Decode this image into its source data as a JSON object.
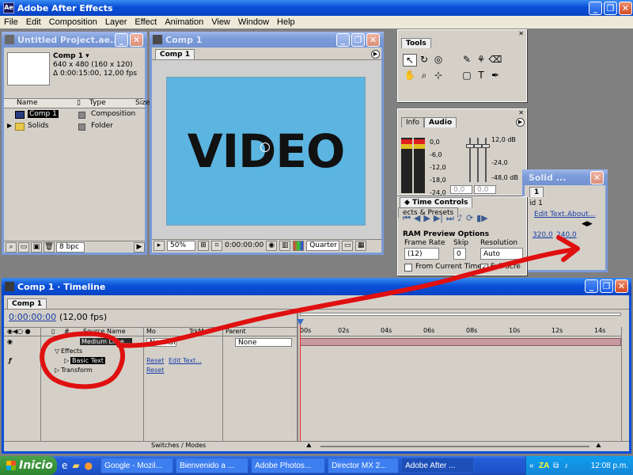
{
  "app": {
    "title": "Adobe After Effects"
  },
  "menu": [
    "File",
    "Edit",
    "Composition",
    "Layer",
    "Effect",
    "Animation",
    "View",
    "Window",
    "Help"
  ],
  "project": {
    "title": "Untitled Project.ae...",
    "comp_name": "Comp 1 ▾",
    "comp_info1": "640 x 480  (160 x 120)",
    "comp_info2": "Δ 0:00:15:00, 12,00 fps",
    "col_name": "Name",
    "col_type": "Type",
    "col_size": "Size",
    "items": [
      {
        "name": "Comp 1",
        "type": "Composition"
      },
      {
        "name": "Solids",
        "type": "Folder"
      }
    ],
    "bpc": "8 bpc"
  },
  "comp": {
    "title": "Comp 1",
    "tab": "Comp 1",
    "video_text": "VIDEO",
    "zoom": "50%",
    "time": "0:00:00:00",
    "resolution": "Quarter"
  },
  "tools": {
    "title": "Tools"
  },
  "audio": {
    "tab_info": "Info",
    "tab_audio": "Audio",
    "left_scale": [
      "0,0",
      "-6,0",
      "-12,0",
      "-18,0",
      "-24,0"
    ],
    "right_scale": [
      "12,0 dB",
      "-24,0",
      "-48,0 dB"
    ],
    "field1": "0,0",
    "field2": "0,0"
  },
  "time_controls": {
    "title": "Time Controls",
    "tab2": "ects & Presets",
    "ram_preview": "RAM Preview Options",
    "frame_rate_label": "Frame Rate",
    "frame_rate": "(12)",
    "skip_label": "Skip",
    "skip": "0",
    "resolution_label": "Resolution",
    "resolution": "Auto",
    "from_current": "From Current Time",
    "full_screen": "Full Scre"
  },
  "solid": {
    "title": "Solid ...",
    "tab": "1",
    "comp_label": "id 1",
    "edit_text": "Edit Text...",
    "about": "About...",
    "x": "320,0",
    "y": "240,0"
  },
  "timeline": {
    "title": "Comp 1 · Timeline",
    "tab": "Comp 1",
    "time": "0:00:00:00",
    "fps": "(12,00 fps)",
    "col_source": "Source Name",
    "col_mode": "Mo",
    "col_trkmat": "TrkMat",
    "col_parent": "Parent",
    "layer_name": "Medium Lime...",
    "layer_mode": "Normal",
    "parent_value": "None",
    "effects": "Effects",
    "basic_text": "Basic Text",
    "transform": "Transform",
    "reset1": "Reset",
    "edit_text": "Edit Text...",
    "reset2": "Reset",
    "switches_modes": "Switches / Modes",
    "ruler": [
      "00s",
      "02s",
      "04s",
      "06s",
      "08s",
      "10s",
      "12s",
      "14s"
    ]
  },
  "taskbar": {
    "start": "Inicio",
    "items": [
      "Google - Mozil...",
      "Bienvenido a ...",
      "Adobe Photos...",
      "Director MX 2...",
      "Adobe After ..."
    ],
    "clock": "12:08 p.m."
  },
  "colors": {
    "comp_bg": "#5bb5e0",
    "annotation": "#e01010",
    "xp_blue": "#0a4fd8"
  }
}
